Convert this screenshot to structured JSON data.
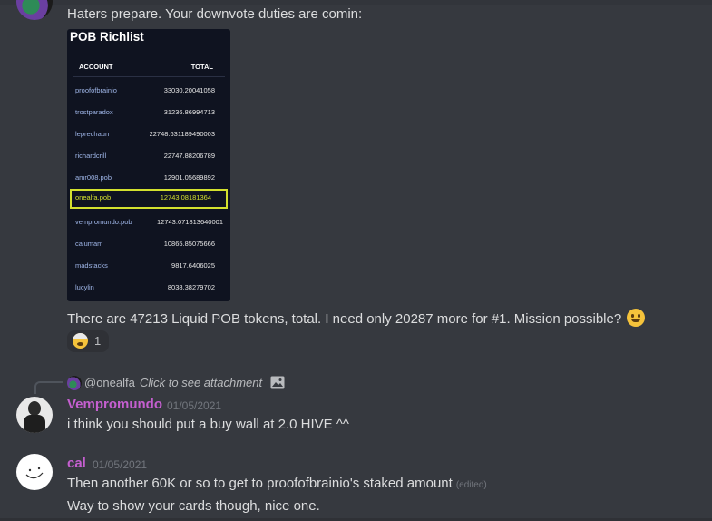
{
  "messages": {
    "top": {
      "text": "Haters prepare.  Your downvote duties are comin:",
      "attachment": {
        "title": "POB Richlist",
        "headers": {
          "account": "ACCOUNT",
          "total": "TOTAL"
        },
        "rows": [
          {
            "account": "proofofbrainio",
            "total": "33030.20041058"
          },
          {
            "account": "trostparadox",
            "total": "31236.86994713"
          },
          {
            "account": "leprechaun",
            "total": "22748.631189490003"
          },
          {
            "account": "richardcrill",
            "total": "22747.88206789"
          },
          {
            "account": "amr008.pob",
            "total": "12901.05689892"
          },
          {
            "account": "onealfa.pob",
            "total": "12743.08181364",
            "highlight": true
          },
          {
            "account": "vempromundo.pob",
            "total": "12743.071813640001"
          },
          {
            "account": "calumam",
            "total": "10865.85075666"
          },
          {
            "account": "madstacks",
            "total": "9817.6406025"
          },
          {
            "account": "lucylin",
            "total": "8038.38279702"
          }
        ]
      },
      "text2": "There are 47213 Liquid POB tokens, total. I need only 20287 more for #1.  Mission possible?",
      "reaction": {
        "emoji": "exploding-head-icon",
        "count": "1"
      }
    },
    "vempromundo": {
      "reply_user": "@onealfa",
      "reply_text": "Click to see attachment",
      "username": "Vempromundo",
      "timestamp": "01/05/2021",
      "text": "i think you should put a buy wall at 2.0 HIVE ^^"
    },
    "cal": {
      "username": "cal",
      "timestamp": "01/05/2021",
      "text1": "Then another 60K or so to get to proofofbrainio's staked amount",
      "edited": "(edited)",
      "text2": "Way to show your cards though, nice one."
    }
  },
  "colors": {
    "background": "#36393f",
    "username": "#c55fd0",
    "highlight": "#d3e02e"
  }
}
